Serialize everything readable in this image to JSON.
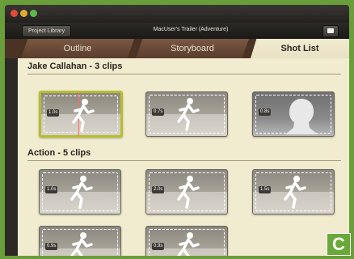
{
  "window": {
    "library_button": "Project Library",
    "title": "MacUser's Trailer (Adventure)"
  },
  "tabs": [
    {
      "label": "Outline"
    },
    {
      "label": "Storyboard"
    },
    {
      "label": "Shot List",
      "selected": true
    }
  ],
  "sections": [
    {
      "title": "Jake Callahan - 3 clips",
      "clips": [
        {
          "duration": "1.0s",
          "figure": "runner-icon",
          "selected": true
        },
        {
          "duration": "0.7s",
          "figure": "runner-icon"
        },
        {
          "duration": "0.8s",
          "figure": "portrait-head-icon"
        }
      ]
    },
    {
      "title": "Action - 5 clips",
      "clips": [
        {
          "duration": "1.0s",
          "figure": "runner-icon"
        },
        {
          "duration": "2.0s",
          "figure": "runner-icon"
        },
        {
          "duration": "1.5s",
          "figure": "runner-icon"
        },
        {
          "duration": "0.9s",
          "figure": "runner-icon"
        },
        {
          "duration": "0.9s",
          "figure": "runner-icon"
        }
      ]
    }
  ],
  "corner_badge": "C",
  "colors": {
    "accent_selection": "#b8bd2e",
    "content_bg": "#f1ecd0",
    "badge_green": "#6aa83a"
  }
}
